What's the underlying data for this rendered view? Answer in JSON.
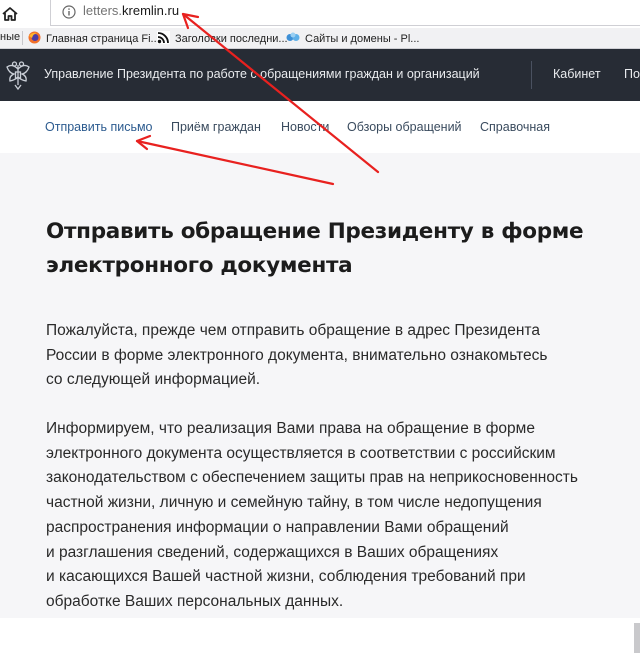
{
  "browser": {
    "url_host": "letters.",
    "url_domain": "kremlin.ru",
    "bookmarks": [
      {
        "label": "ные",
        "icon": "none"
      },
      {
        "label": "Главная страница Fi...",
        "icon": "firefox-icon"
      },
      {
        "label": "Заголовки последни...",
        "icon": "rss-icon"
      },
      {
        "label": "Сайты и домены - Pl...",
        "icon": "plesk-icon"
      }
    ]
  },
  "site": {
    "title": "Управление Президента по работе с обращениями граждан и организаций",
    "cabinet": "Кабинет",
    "more": "По"
  },
  "nav": [
    {
      "label": "Отправить письмо",
      "active": true
    },
    {
      "label": "Приём граждан",
      "active": false
    },
    {
      "label": "Новости",
      "active": false
    },
    {
      "label": "Обзоры обращений",
      "active": false
    },
    {
      "label": "Справочная",
      "active": false
    }
  ],
  "main": {
    "heading_lines": [
      "Отправить обращение Президенту в форме",
      "электронного документа"
    ],
    "para1": [
      "Пожалуйста, прежде чем отправить обращение в адрес Президента",
      "России в форме электронного документа, внимательно ознакомьтесь",
      "со следующей информацией."
    ],
    "para2": [
      "Информируем, что реализация Вами права на обращение в форме",
      "электронного документа осуществляется в соответствии с российским",
      "законодательством с обеспечением защиты прав на неприкосновенность",
      "частной жизни, личную и семейную тайну, в том числе недопущения",
      "распространения информации о направлении Вами обращений",
      "и разглашения сведений, содержащихся в Ваших обращениях",
      "и касающихся Вашей частной жизни, соблюдения требований при",
      "обработке Ваших персональных данных."
    ]
  },
  "colors": {
    "header_bg": "#272c35",
    "content_bg": "#f6f6f8",
    "active_link": "#2c5b8f",
    "annotation_arrow": "#e8211f"
  }
}
